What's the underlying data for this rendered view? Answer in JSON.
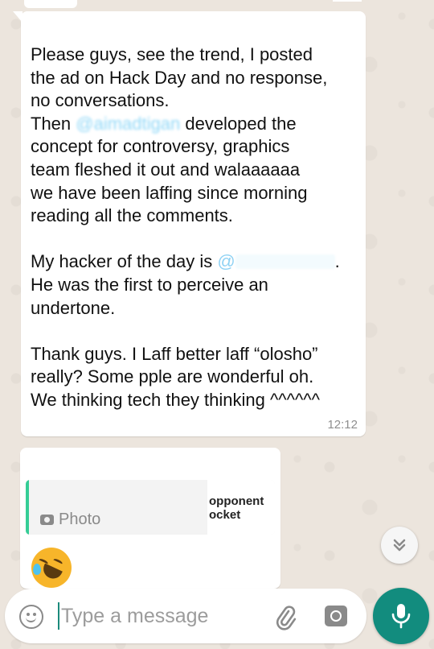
{
  "chat": {
    "message_main": {
      "line1": "Please guys, see the trend, I posted",
      "line2": "the ad on Hack Day and no response,",
      "line3": "no conversations.",
      "line4_pre": "Then ",
      "mention1": "@aimadtigan",
      "line4_post": " developed the",
      "line5": "concept for controversy, graphics",
      "line6": "team fleshed it out and walaaaaaa",
      "line7": "we have been laffing since morning",
      "line8": "reading all the comments.",
      "line9_pre": "My hacker of the day is ",
      "mention2_at": "@",
      "line9_post": ".",
      "line10": "He was the first to perceive an",
      "line11": "undertone.",
      "line12": "Thank guys. I Laff better laff “olosho”",
      "line13": "really? Some pple are wonderful oh.",
      "line14": "We thinking tech they thinking ^^^^^^",
      "time": "12:12"
    },
    "message_reply": {
      "quoted_type": "Photo",
      "thumb_line1": "opponent",
      "thumb_line2": "ocket",
      "emoji": "rolling-on-floor-laughing"
    }
  },
  "composer": {
    "placeholder": "Type a message"
  },
  "colors": {
    "accent": "#128c7e",
    "quote_bar": "#35cd96",
    "mention": "#34b7f1",
    "background": "#ece5dd"
  }
}
